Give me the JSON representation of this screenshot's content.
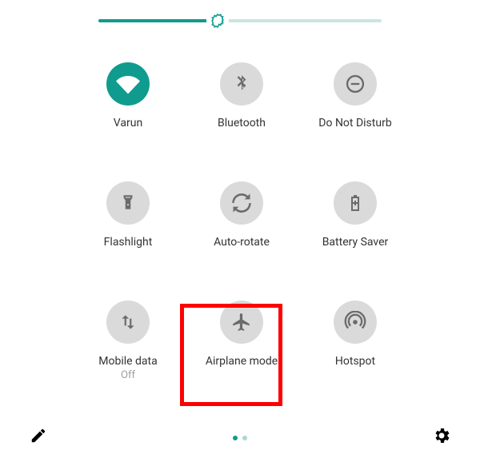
{
  "brightness": {
    "percent": 42
  },
  "tiles": {
    "wifi": {
      "label": "Varun",
      "state": "on"
    },
    "bluetooth": {
      "label": "Bluetooth",
      "state": "off"
    },
    "dnd": {
      "label": "Do Not Disturb",
      "state": "off"
    },
    "flashlight": {
      "label": "Flashlight",
      "state": "off"
    },
    "autorotate": {
      "label": "Auto-rotate",
      "state": "off"
    },
    "battery": {
      "label": "Battery Saver",
      "state": "off"
    },
    "mobiledata": {
      "label": "Mobile data",
      "sub": "Off",
      "state": "off"
    },
    "airplane": {
      "label": "Airplane mode",
      "state": "off"
    },
    "hotspot": {
      "label": "Hotspot",
      "state": "off"
    }
  },
  "highlight": {
    "target": "airplane"
  },
  "pager": {
    "pages": 2,
    "current": 1
  },
  "colors": {
    "accent": "#0f9b8e",
    "tile_off": "#dadada",
    "icon": "#6b6b6b",
    "highlight": "#ff0000"
  }
}
